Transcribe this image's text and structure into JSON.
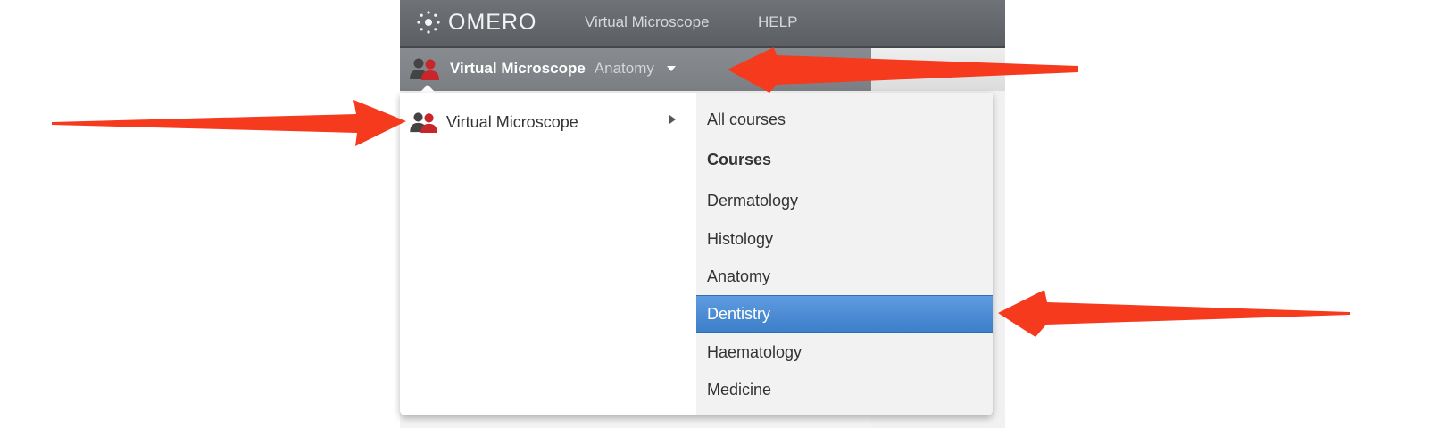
{
  "topbar": {
    "logo_text": "OMERO",
    "nav": [
      "Virtual Microscope",
      "HELP"
    ]
  },
  "group_switcher": {
    "group_name": "Virtual Microscope",
    "current_user": "Anatomy"
  },
  "dropdown": {
    "group_label": "Virtual Microscope",
    "items": [
      {
        "label": "All courses",
        "type": "item"
      },
      {
        "label": "Courses",
        "type": "header"
      },
      {
        "label": "Dermatology",
        "type": "item"
      },
      {
        "label": "Histology",
        "type": "item"
      },
      {
        "label": "Anatomy",
        "type": "item"
      },
      {
        "label": "Dentistry",
        "type": "item",
        "selected": true
      },
      {
        "label": "Haematology",
        "type": "item"
      },
      {
        "label": "Medicine",
        "type": "item"
      }
    ]
  },
  "colors": {
    "topbar": "#5b5f63",
    "secondbar": "#7b7f83",
    "selected": "#4a89d2",
    "annotation_arrow": "#f53a1e",
    "group_icon_dark": "#444444",
    "group_icon_red": "#c8262a"
  }
}
